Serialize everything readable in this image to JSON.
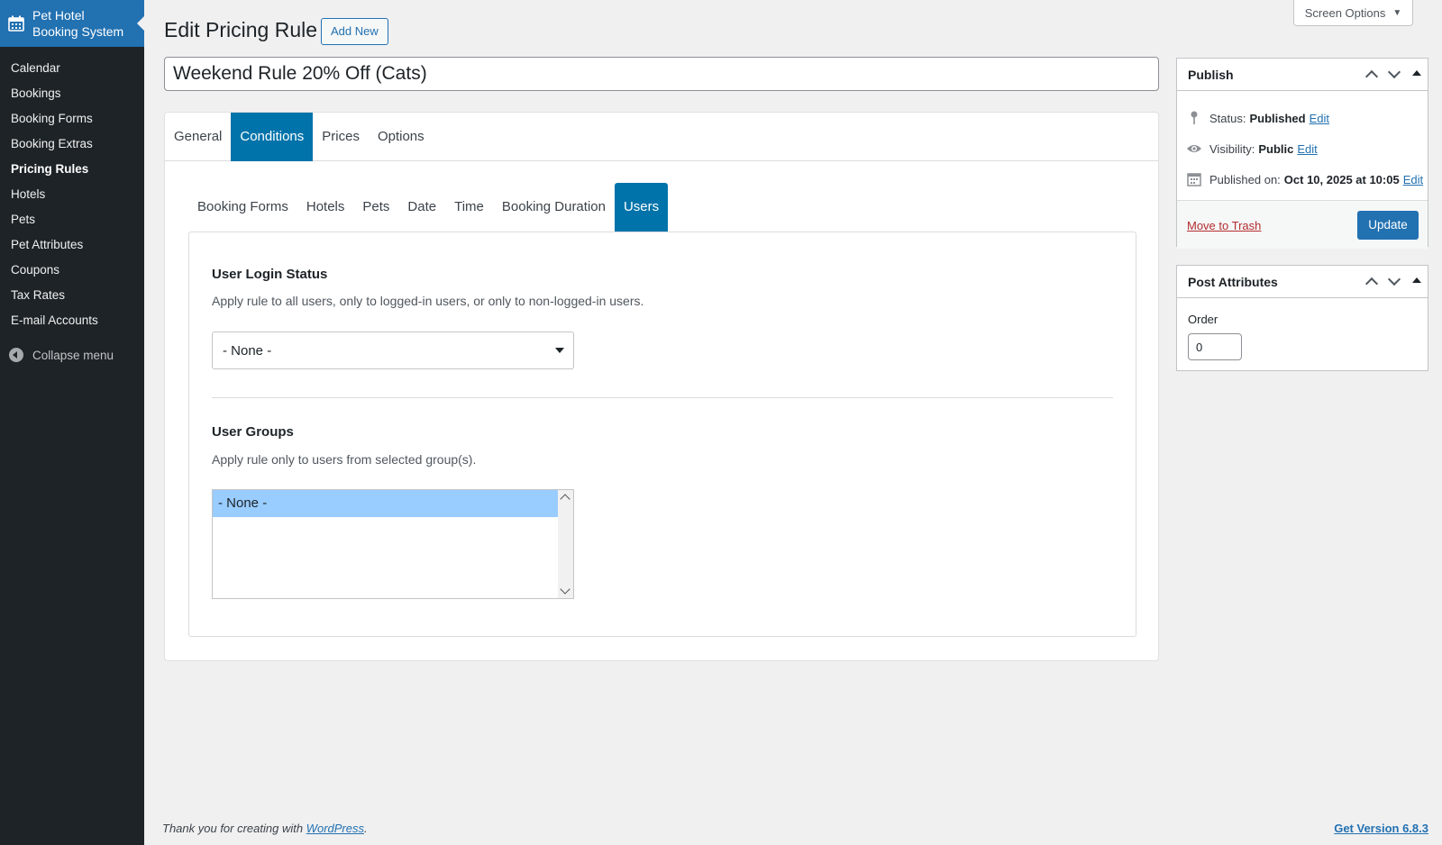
{
  "sidebar": {
    "brand": "Pet Hotel Booking System",
    "items": [
      {
        "label": "Calendar"
      },
      {
        "label": "Bookings"
      },
      {
        "label": "Booking Forms"
      },
      {
        "label": "Booking Extras"
      },
      {
        "label": "Pricing Rules"
      },
      {
        "label": "Hotels"
      },
      {
        "label": "Pets"
      },
      {
        "label": "Pet Attributes"
      },
      {
        "label": "Coupons"
      },
      {
        "label": "Tax Rates"
      },
      {
        "label": "E-mail Accounts"
      }
    ],
    "current": "Pricing Rules",
    "collapse_label": "Collapse menu"
  },
  "header": {
    "screen_options": "Screen Options",
    "title": "Edit Pricing Rule",
    "add_new": "Add New"
  },
  "post_title": "Weekend Rule 20% Off (Cats)",
  "tabs": {
    "main": [
      "General",
      "Conditions",
      "Prices",
      "Options"
    ],
    "main_active": "Conditions",
    "sub": [
      "Booking Forms",
      "Hotels",
      "Pets",
      "Date",
      "Time",
      "Booking Duration",
      "Users"
    ],
    "sub_active": "Users"
  },
  "users": {
    "login_title": "User Login Status",
    "login_desc": "Apply rule to all users, only to logged-in users, or only to non-logged-in users.",
    "login_value": "- None -",
    "groups_title": "User Groups",
    "groups_desc": "Apply rule only to users from selected group(s).",
    "groups_options": [
      "- None -"
    ]
  },
  "publish": {
    "title": "Publish",
    "status_label": "Status:",
    "status_value": "Published",
    "visibility_label": "Visibility:",
    "visibility_value": "Public",
    "published_label": "Published on:",
    "published_value": "Oct 10, 2025 at 10:05",
    "edit_label": "Edit",
    "trash_label": "Move to Trash",
    "update_label": "Update"
  },
  "attributes": {
    "title": "Post Attributes",
    "order_label": "Order",
    "order_value": "0"
  },
  "footer": {
    "thanks_prefix": "Thank you for creating with ",
    "wp_link": "WordPress",
    "thanks_suffix": ".",
    "version": "Get Version 6.8.3"
  },
  "colors": {
    "admin_blue": "#2271b1",
    "tab_active": "#0073aa",
    "sidebar_bg": "#1d2327",
    "selected_option": "#99ccff",
    "trash_red": "#b32d2e"
  }
}
